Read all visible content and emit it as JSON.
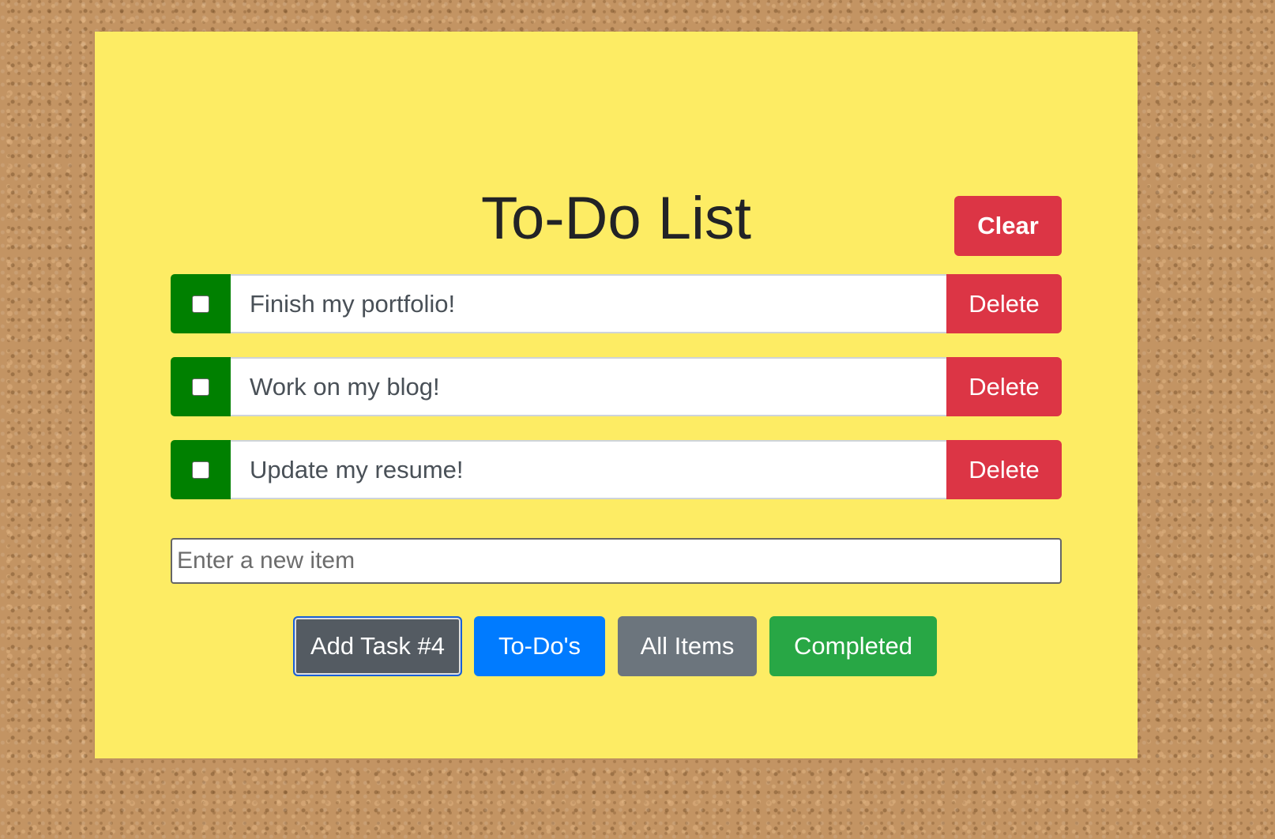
{
  "app": {
    "title": "To-Do List"
  },
  "toolbar": {
    "clear_label": "Clear"
  },
  "todos": [
    {
      "text": "Finish my portfolio!",
      "completed": false,
      "delete_label": "Delete"
    },
    {
      "text": "Work on my blog!",
      "completed": false,
      "delete_label": "Delete"
    },
    {
      "text": "Update my resume!",
      "completed": false,
      "delete_label": "Delete"
    }
  ],
  "new_item": {
    "placeholder": "Enter a new item",
    "value": ""
  },
  "actions": {
    "add_label": "Add Task #4",
    "todos_label": "To-Do's",
    "all_label": "All Items",
    "completed_label": "Completed"
  },
  "colors": {
    "paper": "#fdec64",
    "danger": "#dc3545",
    "checkbox_cell": "#008000",
    "add": "#545b62",
    "primary": "#007bff",
    "secondary": "#6c757d",
    "success": "#28a745"
  }
}
